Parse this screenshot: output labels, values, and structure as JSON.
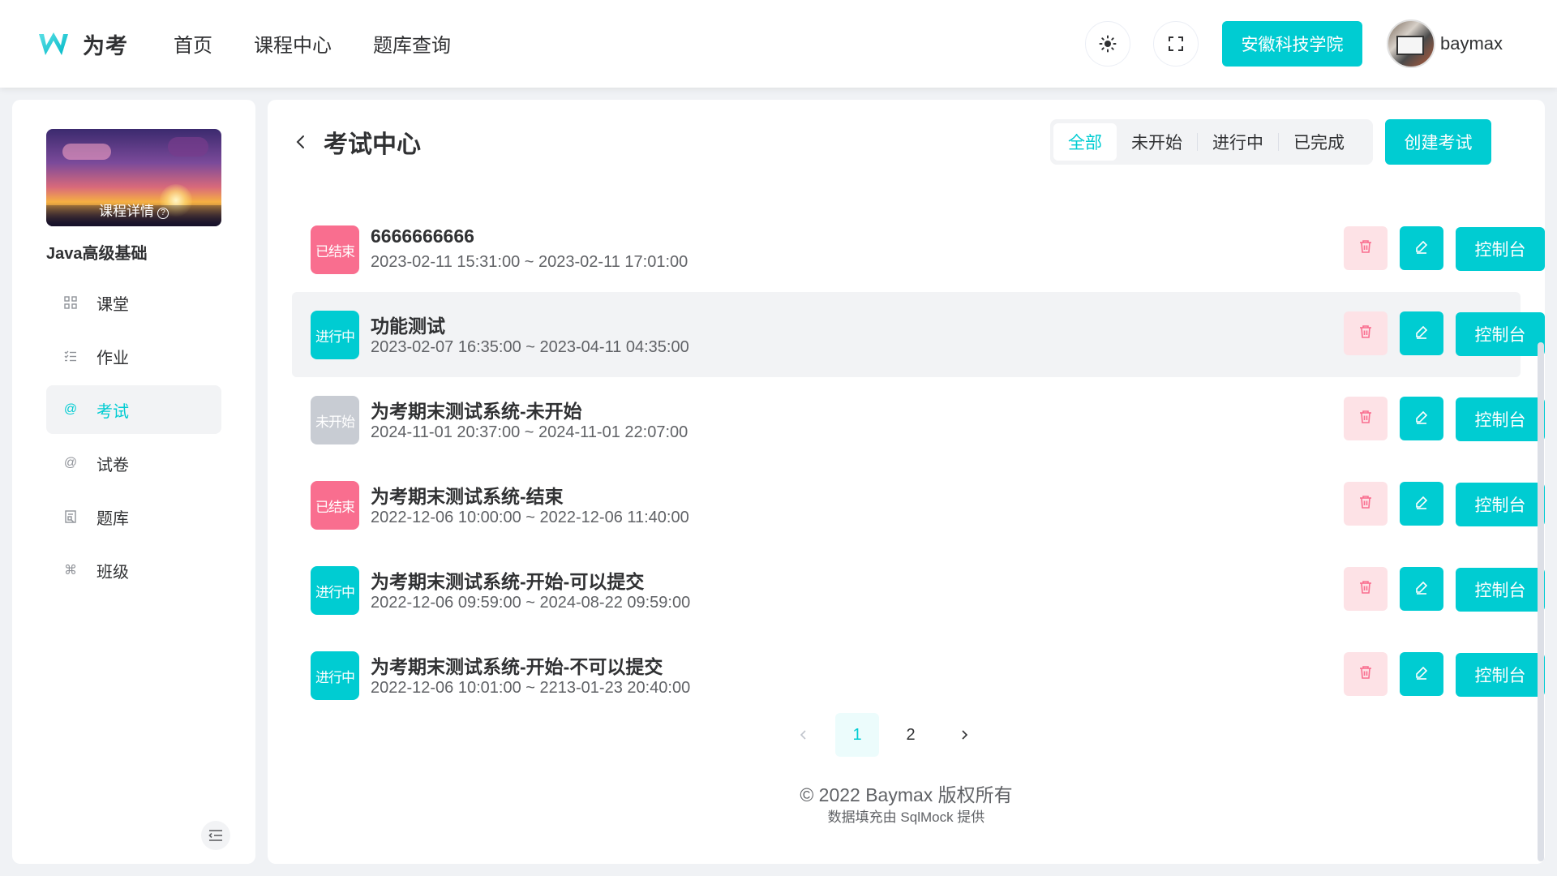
{
  "header": {
    "logo_text": "为考",
    "nav": [
      "首页",
      "课程中心",
      "题库查询"
    ],
    "school_button": "安徽科技学院",
    "username": "baymax",
    "theme_icon": "sun-icon",
    "fullscreen_icon": "fullscreen-icon"
  },
  "sidebar": {
    "cover_label": "课程详情",
    "course_name": "Java高级基础",
    "menu": [
      {
        "label": "课堂",
        "icon": "grid-icon"
      },
      {
        "label": "作业",
        "icon": "checklist-icon"
      },
      {
        "label": "考试",
        "icon": "at-icon"
      },
      {
        "label": "试卷",
        "icon": "at-icon"
      },
      {
        "label": "题库",
        "icon": "document-icon"
      },
      {
        "label": "班级",
        "icon": "command-icon"
      }
    ],
    "active_menu": "考试"
  },
  "main": {
    "title": "考试中心",
    "filters": [
      "全部",
      "未开始",
      "进行中",
      "已完成"
    ],
    "active_filter": "全部",
    "create_button": "创建考试",
    "console_label": "控制台",
    "exams": [
      {
        "status": "已结束",
        "status_type": "ended",
        "title": "6666666666",
        "time": "2023-02-11 15:31:00 ~ 2023-02-11 17:01:00"
      },
      {
        "status": "进行中",
        "status_type": "running",
        "title": "功能测试",
        "time": "2023-02-07 16:35:00 ~ 2023-04-11 04:35:00"
      },
      {
        "status": "未开始",
        "status_type": "pending",
        "title": "为考期末测试系统-未开始",
        "time": "2024-11-01 20:37:00 ~ 2024-11-01 22:07:00"
      },
      {
        "status": "已结束",
        "status_type": "ended",
        "title": "为考期末测试系统-结束",
        "time": "2022-12-06 10:00:00 ~ 2022-12-06 11:40:00"
      },
      {
        "status": "进行中",
        "status_type": "running",
        "title": "为考期末测试系统-开始-可以提交",
        "time": "2022-12-06 09:59:00 ~ 2024-08-22 09:59:00"
      },
      {
        "status": "进行中",
        "status_type": "running",
        "title": "为考期末测试系统-开始-不可以提交",
        "time": "2022-12-06 10:01:00 ~ 2213-01-23 20:40:00"
      }
    ],
    "pagination": {
      "pages": [
        "1",
        "2"
      ],
      "current": "1"
    },
    "footer": "© 2022 Baymax 版权所有",
    "footer_sub": "数据填充由 SqlMock 提供"
  },
  "colors": {
    "accent": "#00ccd2",
    "ended": "#f96e8f",
    "pending": "#c8ccd3",
    "danger_bg": "#fde2e6"
  }
}
